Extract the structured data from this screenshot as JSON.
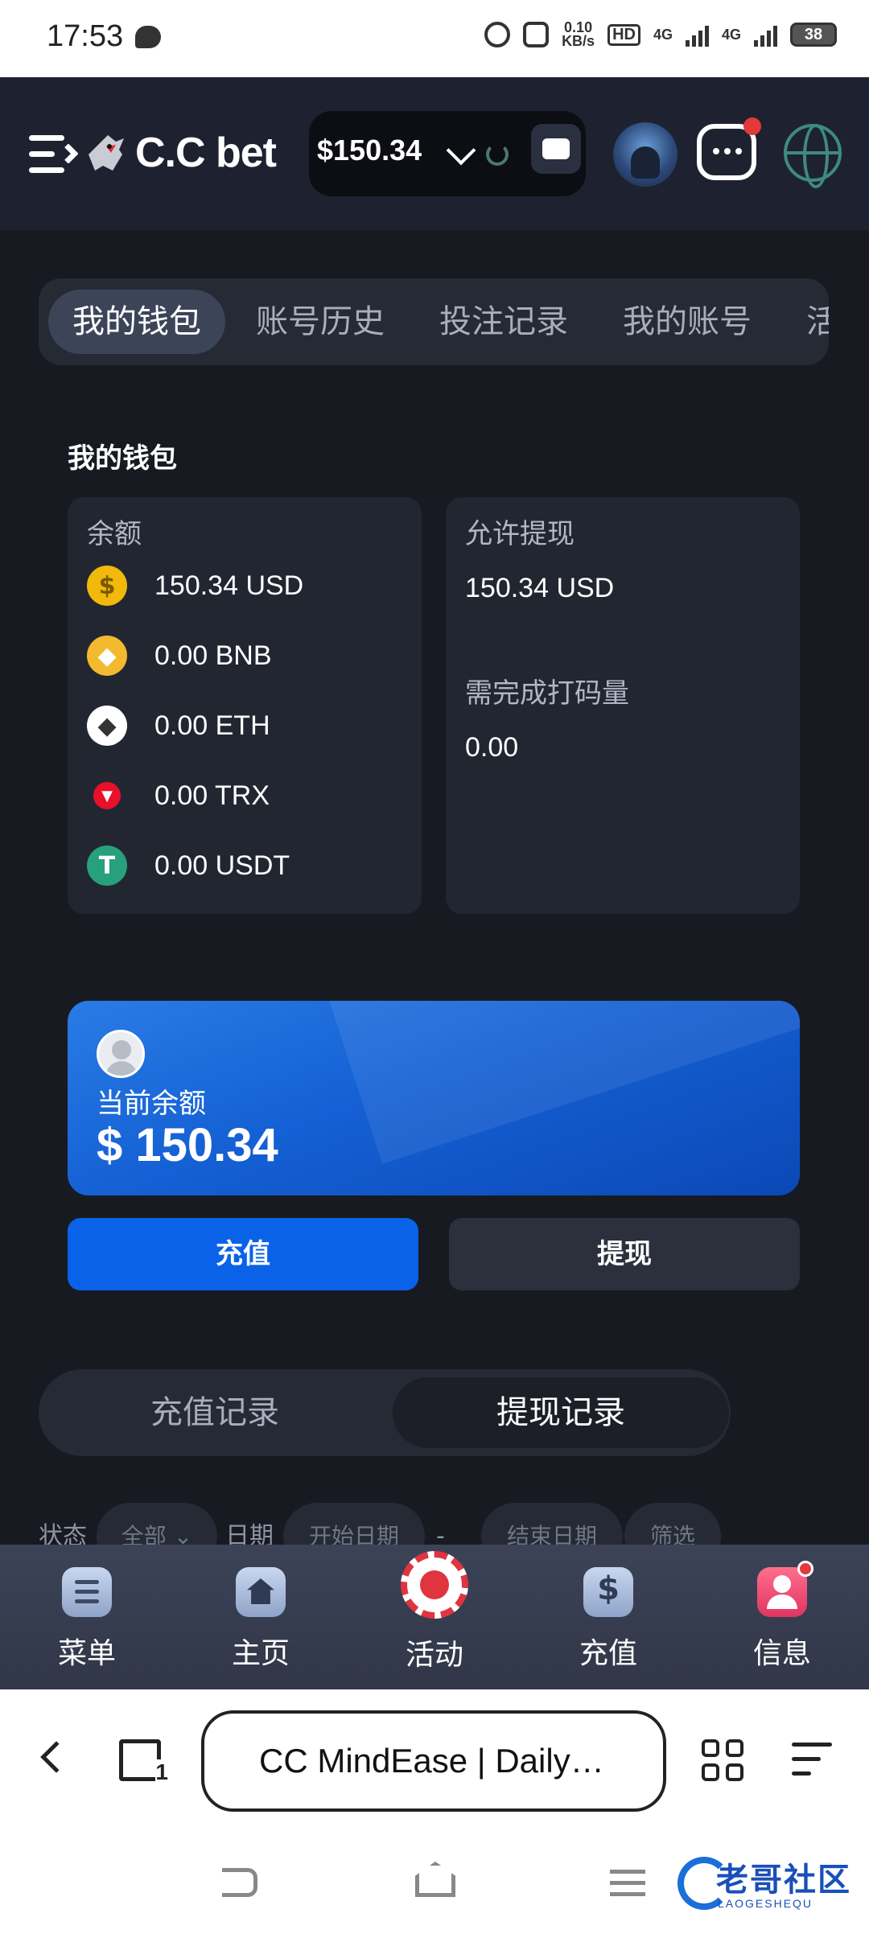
{
  "status_bar": {
    "time": "17:53",
    "net_speed_top": "0.10",
    "net_speed_bottom": "KB/s",
    "hd_label": "HD",
    "net1": "4G",
    "net2": "4G",
    "battery": "38"
  },
  "header": {
    "logo_text": "C.C bet",
    "balance": "$150.34",
    "icons": [
      "menu-icon",
      "chevron-down-icon",
      "refresh-icon",
      "wallet-icon",
      "avatar",
      "message-icon",
      "globe-icon"
    ]
  },
  "tabs": [
    "我的钱包",
    "账号历史",
    "投注记录",
    "我的账号",
    "活"
  ],
  "wallet": {
    "section_title": "我的钱包",
    "balance_label": "余额",
    "coins": [
      {
        "icon": "usd-coin-icon",
        "symbol": "$",
        "color": "#f0b90b",
        "amount": "150.34 USD"
      },
      {
        "icon": "bnb-coin-icon",
        "symbol": "◆",
        "color": "#f3ba2f",
        "amount": "0.00 BNB"
      },
      {
        "icon": "eth-coin-icon",
        "symbol": "◆",
        "color": "#ffffff",
        "amount": "0.00 ETH"
      },
      {
        "icon": "trx-coin-icon",
        "symbol": "▼",
        "color": "#e8102a",
        "amount": "0.00 TRX"
      },
      {
        "icon": "usdt-coin-icon",
        "symbol": "T",
        "color": "#26a17b",
        "amount": "0.00 USDT"
      }
    ],
    "withdrawable_label": "允许提现",
    "withdrawable_value": "150.34 USD",
    "wager_label": "需完成打码量",
    "wager_value": "0.00"
  },
  "banner": {
    "label": "当前余额",
    "amount": "$ 150.34"
  },
  "actions": {
    "deposit": "充值",
    "withdraw": "提现"
  },
  "records": {
    "deposit_tab": "充值记录",
    "withdraw_tab": "提现记录"
  },
  "filter": {
    "status_label": "状态",
    "status_value": "全部",
    "date_label": "日期",
    "start_placeholder": "开始日期",
    "separator": "-",
    "end_placeholder": "结束日期",
    "filter_button": "筛选"
  },
  "bottom_nav": [
    {
      "icon": "menu-list-icon",
      "label": "菜单"
    },
    {
      "icon": "home-icon",
      "label": "主页"
    },
    {
      "icon": "casino-chip-icon",
      "label": "活动"
    },
    {
      "icon": "deposit-icon",
      "label": "充值"
    },
    {
      "icon": "user-message-icon",
      "label": "信息"
    }
  ],
  "browser": {
    "url_title": "CC MindEase | Daily Drop",
    "tab_count": "1"
  },
  "watermark": {
    "text": "老哥社区",
    "sub": "LAOGESHEQU"
  }
}
